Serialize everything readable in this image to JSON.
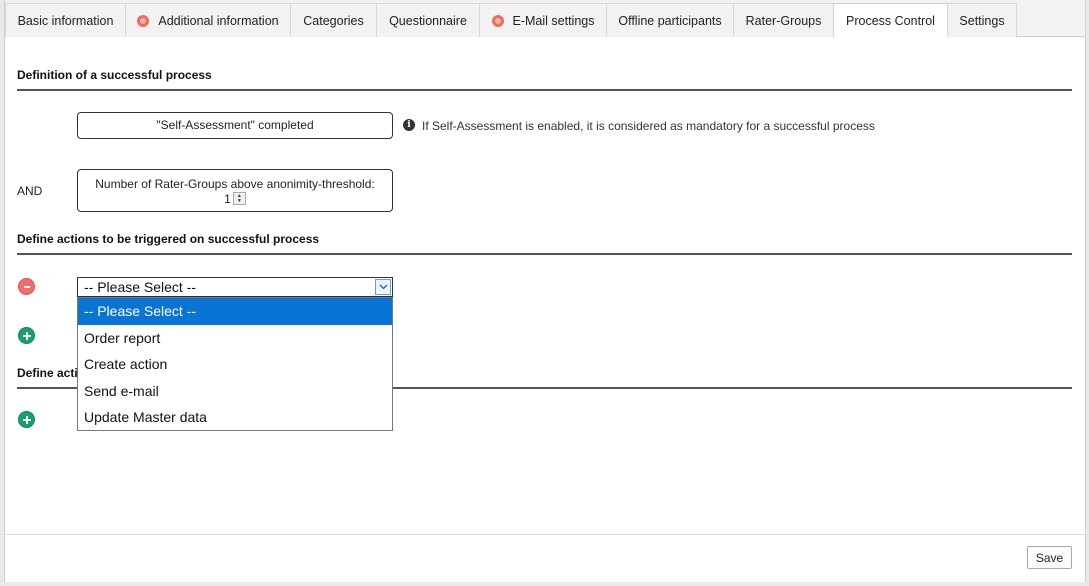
{
  "tabs": [
    {
      "label": "Basic information",
      "warning": false,
      "active": false
    },
    {
      "label": "Additional information",
      "warning": true,
      "active": false
    },
    {
      "label": "Categories",
      "warning": false,
      "active": false
    },
    {
      "label": "Questionnaire",
      "warning": false,
      "active": false
    },
    {
      "label": "E-Mail settings",
      "warning": true,
      "active": false
    },
    {
      "label": "Offline participants",
      "warning": false,
      "active": false
    },
    {
      "label": "Rater-Groups",
      "warning": false,
      "active": false
    },
    {
      "label": "Process Control",
      "warning": false,
      "active": true
    },
    {
      "label": "Settings",
      "warning": false,
      "active": false
    }
  ],
  "sections": {
    "definition_title": "Definition of a successful process",
    "self_assessment_label": "\"Self-Assessment\" completed",
    "self_assessment_info": "If Self-Assessment is enabled, it is considered as mandatory for a successful process",
    "and_label": "AND",
    "rater_groups_label": "Number of Rater-Groups above anonimity-threshold:",
    "rater_groups_value": "1",
    "actions_success_title": "Define actions to be triggered on successful process",
    "actions_other_title_partial": "Define acti"
  },
  "action_select": {
    "selected": "-- Please Select --",
    "options": [
      "-- Please Select --",
      "Order report",
      "Create action",
      "Send e-mail",
      "Update Master data"
    ]
  },
  "footer": {
    "save_label": "Save"
  },
  "icons": {
    "warning": "warning-icon",
    "info": "info-icon",
    "remove": "remove-circle-icon",
    "add": "add-circle-icon",
    "dropdown": "chevron-down-icon"
  },
  "colors": {
    "selected_option_bg": "#0a74d4",
    "remove_button": "#f26c6c",
    "add_button": "#14a06f",
    "warning_icon": "#f06b5b"
  }
}
